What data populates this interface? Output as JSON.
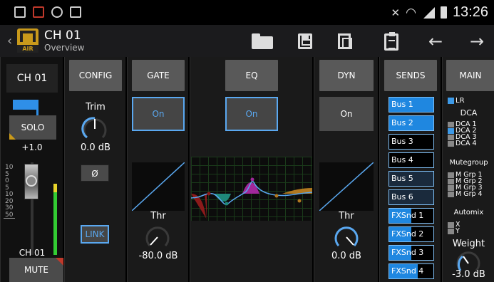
{
  "status_bar": {
    "time": "13:26"
  },
  "action_bar": {
    "title": "CH 01",
    "subtitle": "Overview",
    "logo_text": "AIR",
    "buttons": [
      "folder-open",
      "save",
      "copy",
      "paste",
      "undo",
      "redo"
    ]
  },
  "strip": {
    "channel_name": "CH 01",
    "solo_label": "SOLO",
    "gain_value": "+1.0",
    "fader_scale": [
      "10",
      "5",
      "0",
      "5",
      "10",
      "20",
      "30",
      "50"
    ],
    "channel_label_bottom": "CH 01",
    "mute_label": "MUTE",
    "link_color": "#2f8fe8"
  },
  "config": {
    "header": "CONFIG",
    "trim_label": "Trim",
    "trim_value": "0.0 dB",
    "phase_label": "Ø",
    "link_label": "LINK"
  },
  "gate": {
    "header": "GATE",
    "on_label": "On",
    "thr_label": "Thr",
    "thr_value": "-80.0 dB"
  },
  "eq": {
    "header": "EQ",
    "on_label": "On"
  },
  "dyn": {
    "header": "DYN",
    "on_label": "On",
    "thr_label": "Thr",
    "thr_value": "0.0 dB"
  },
  "sends": {
    "header": "SENDS",
    "items": [
      {
        "label": "Bus 1",
        "level": 1.0
      },
      {
        "label": "Bus 2",
        "level": 1.0
      },
      {
        "label": "Bus 3",
        "level": 0.0
      },
      {
        "label": "Bus 4",
        "level": 0.0
      },
      {
        "label": "Bus 5",
        "level": 0.0
      },
      {
        "label": "Bus 6",
        "level": 0.0
      },
      {
        "label": "FXSnd 1",
        "level": 0.5
      },
      {
        "label": "FXSnd 2",
        "level": 0.5
      },
      {
        "label": "FXSnd 3",
        "level": 0.5
      },
      {
        "label": "FXSnd 4",
        "level": 0.65
      }
    ]
  },
  "main": {
    "header": "MAIN",
    "lr_label": "LR",
    "dca_title": "DCA",
    "dca_items": [
      "DCA 1",
      "DCA 2",
      "DCA 3",
      "DCA 4"
    ],
    "mutegroup_title": "Mutegroup",
    "mute_items": [
      "M Grp 1",
      "M Grp 2",
      "M Grp 3",
      "M Grp 4"
    ],
    "automix_title": "Automix",
    "automix_items": [
      "X",
      "Y"
    ],
    "weight_label": "Weight",
    "weight_value": "-3.0 dB"
  },
  "colors": {
    "accent": "#5aa8f0",
    "eq_low": "#8b1a1a",
    "eq_lowmid": "#1f8a7a",
    "eq_himid": "#a0289a",
    "eq_high": "#b07820"
  }
}
